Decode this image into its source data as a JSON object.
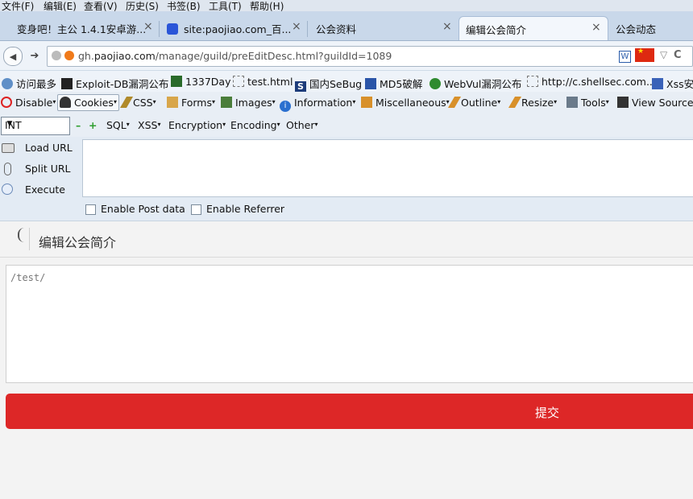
{
  "menu": [
    "文件(F)",
    "编辑(E)",
    "查看(V)",
    "历史(S)",
    "书签(B)",
    "工具(T)",
    "帮助(H)"
  ],
  "tabs": [
    {
      "title": "变身吧！主公 1.4.1安卓游...",
      "close": "×"
    },
    {
      "title": "site:paojiao.com_百...",
      "close": "×"
    },
    {
      "title": "公会资料",
      "close": "×"
    },
    {
      "title": "编辑公会简介",
      "close": "×"
    },
    {
      "title": "公会动态"
    }
  ],
  "nav": {
    "back": "◀",
    "forward": "➔",
    "url_prefix": "gh.",
    "url_domain": "paojiao.com",
    "url_path": "/manage/guild/preEditDesc.html?guildId=1089",
    "word_icon": "W",
    "dropdown": "▽",
    "reload": "C"
  },
  "bookmarks": [
    "访问最多",
    "Exploit-DB漏洞公布",
    "1337Day",
    "test.html",
    "国内SeBug",
    "MD5破解",
    "WebVul漏洞公布",
    "http://c.shellsec.com...",
    "Xss安"
  ],
  "devtoolbar": [
    "Disable",
    "Cookies",
    "CSS",
    "Forms",
    "Images",
    "Information",
    "Miscellaneous",
    "Outline",
    "Resize",
    "Tools",
    "View Source"
  ],
  "hackbar": {
    "select_value": "INT",
    "minus": "–",
    "plus": "+",
    "menus": [
      "SQL",
      "XSS",
      "Encryption",
      "Encoding",
      "Other"
    ],
    "buttons": [
      "Load URL",
      "Split URL",
      "Execute"
    ],
    "checkboxes": [
      "Enable Post data",
      "Enable Referrer"
    ]
  },
  "page": {
    "title": "编辑公会简介",
    "textarea_value": "/test/",
    "submit_label": "提交"
  },
  "colors": {
    "submit": "#dd2727",
    "tabstrip": "#c9d8ea"
  }
}
